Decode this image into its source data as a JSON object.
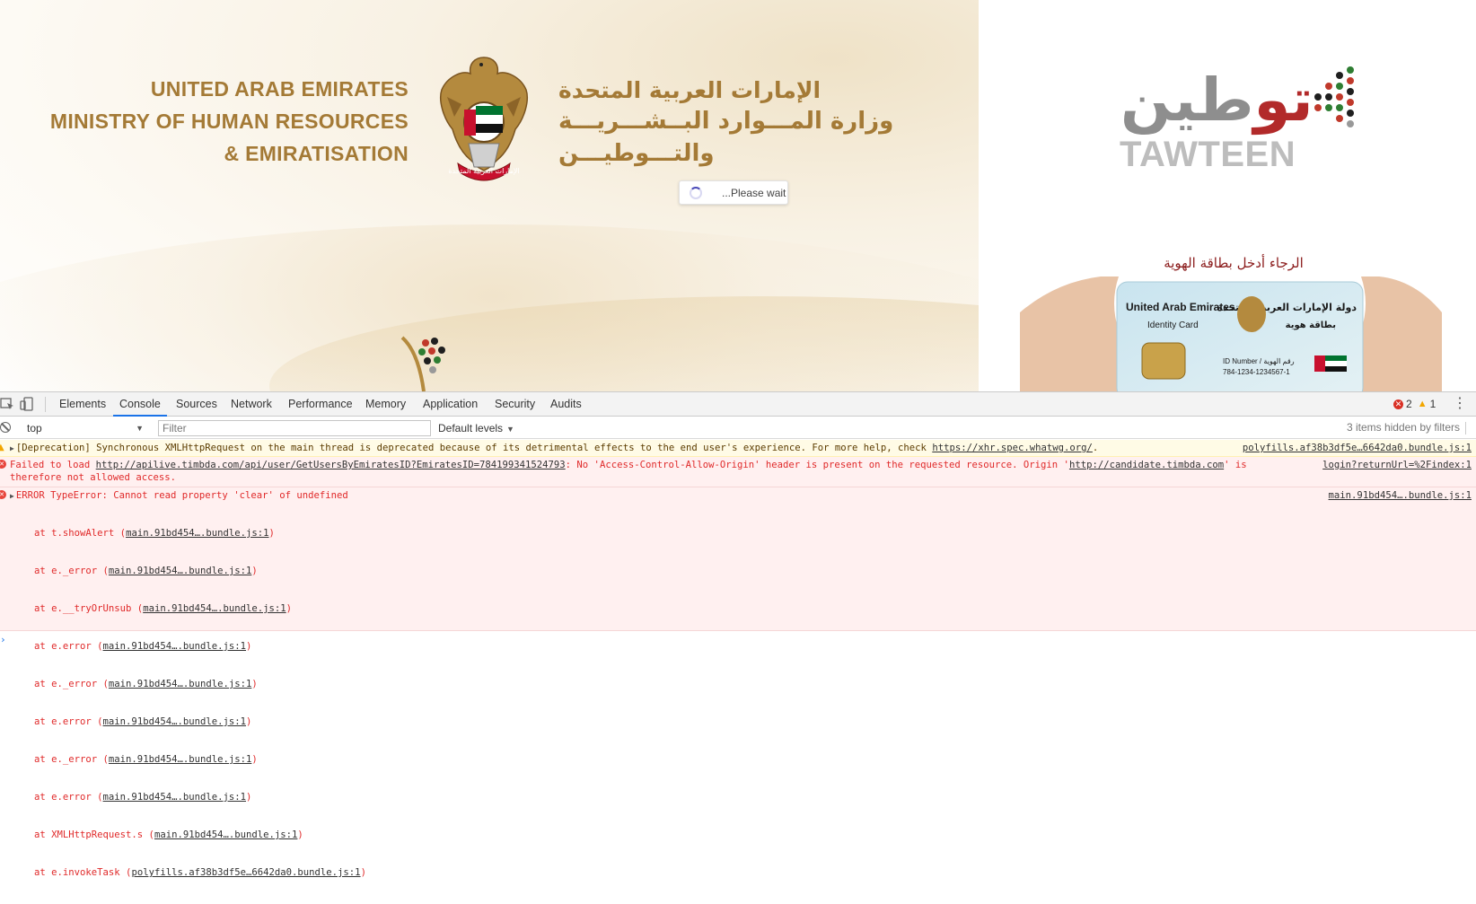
{
  "page": {
    "en_name": [
      "UNITED ARAB EMIRATES",
      "MINISTRY OF HUMAN RESOURCES",
      "& EMIRATISATION"
    ],
    "ar_name": [
      "الإمارات العربية المتحدة",
      "وزارة المـــوارد البــشـــريـــة",
      "والتـــوطيـــن"
    ],
    "loading_text": "...Please wait",
    "tawteen_ar": "توطين",
    "tawteen_en": "TAWTEEN",
    "id_prompt": "الرجاء أدخل بطاقة الهوية",
    "id_card": {
      "en_title": "United Arab Emirates",
      "en_subtitle": "Identity Card",
      "ar_title": "دولة الإمارات العربية المتحدة",
      "ar_subtitle": "بطاقة هوية",
      "id_label": "ID Number / رقم الهوية",
      "id_number": "784-1234-1234567-1"
    },
    "emblem_ribbon": "الإمارات العربية المتحدة"
  },
  "devtools": {
    "tabs": [
      "Elements",
      "Console",
      "Sources",
      "Network",
      "Performance",
      "Memory",
      "Application",
      "Security",
      "Audits"
    ],
    "active_tab": "Console",
    "error_count": "2",
    "warning_count": "1",
    "context": "top",
    "filter_placeholder": "Filter",
    "levels": "Default levels",
    "hidden_text": "3 items hidden by filters",
    "messages": {
      "deprecation": {
        "prefix": "[Deprecation] Synchronous XMLHttpRequest on the main thread is deprecated because of its detrimental effects to the end user's experience. For more help, check ",
        "link": "https://xhr.spec.whatwg.org/",
        "suffix": ".",
        "source": "polyfills.af38b3df5e…6642da0.bundle.js:1"
      },
      "cors": {
        "line1_a": "Failed to load ",
        "url": "http://apilive.timbda.com/api/user/GetUsersByEmiratesID?EmiratesID=784199341524793",
        "line1_b": ": No 'Access-Control-Allow-Origin' header is present on the requested resource. Origin '",
        "origin": "http://candidate.timbda.com",
        "line1_c": "' is",
        "line2": "therefore not allowed access.",
        "source": "login?returnUrl=%2Findex:1"
      },
      "typeerror": {
        "title": "ERROR TypeError: Cannot read property 'clear' of undefined",
        "source": "main.91bd454….bundle.js:1",
        "stack": [
          {
            "fn": "at t.showAlert (",
            "file": "main.91bd454….bundle.js:1",
            "end": ")"
          },
          {
            "fn": "at e._error (",
            "file": "main.91bd454….bundle.js:1",
            "end": ")"
          },
          {
            "fn": "at e.__tryOrUnsub (",
            "file": "main.91bd454….bundle.js:1",
            "end": ")"
          },
          {
            "fn": "at e.error (",
            "file": "main.91bd454….bundle.js:1",
            "end": ")"
          },
          {
            "fn": "at e._error (",
            "file": "main.91bd454….bundle.js:1",
            "end": ")"
          },
          {
            "fn": "at e.error (",
            "file": "main.91bd454….bundle.js:1",
            "end": ")"
          },
          {
            "fn": "at e._error (",
            "file": "main.91bd454….bundle.js:1",
            "end": ")"
          },
          {
            "fn": "at e.error (",
            "file": "main.91bd454….bundle.js:1",
            "end": ")"
          },
          {
            "fn": "at XMLHttpRequest.s (",
            "file": "main.91bd454….bundle.js:1",
            "end": ")"
          },
          {
            "fn": "at e.invokeTask (",
            "file": "polyfills.af38b3df5e…6642da0.bundle.js:1",
            "end": ")"
          }
        ]
      }
    }
  },
  "colors": {
    "gold": "#a47a36",
    "tawteen_red": "#b22a2a",
    "prompt_red": "#8b1c1c",
    "console_error": "#e02a2a",
    "accent": "#1a73e8"
  }
}
